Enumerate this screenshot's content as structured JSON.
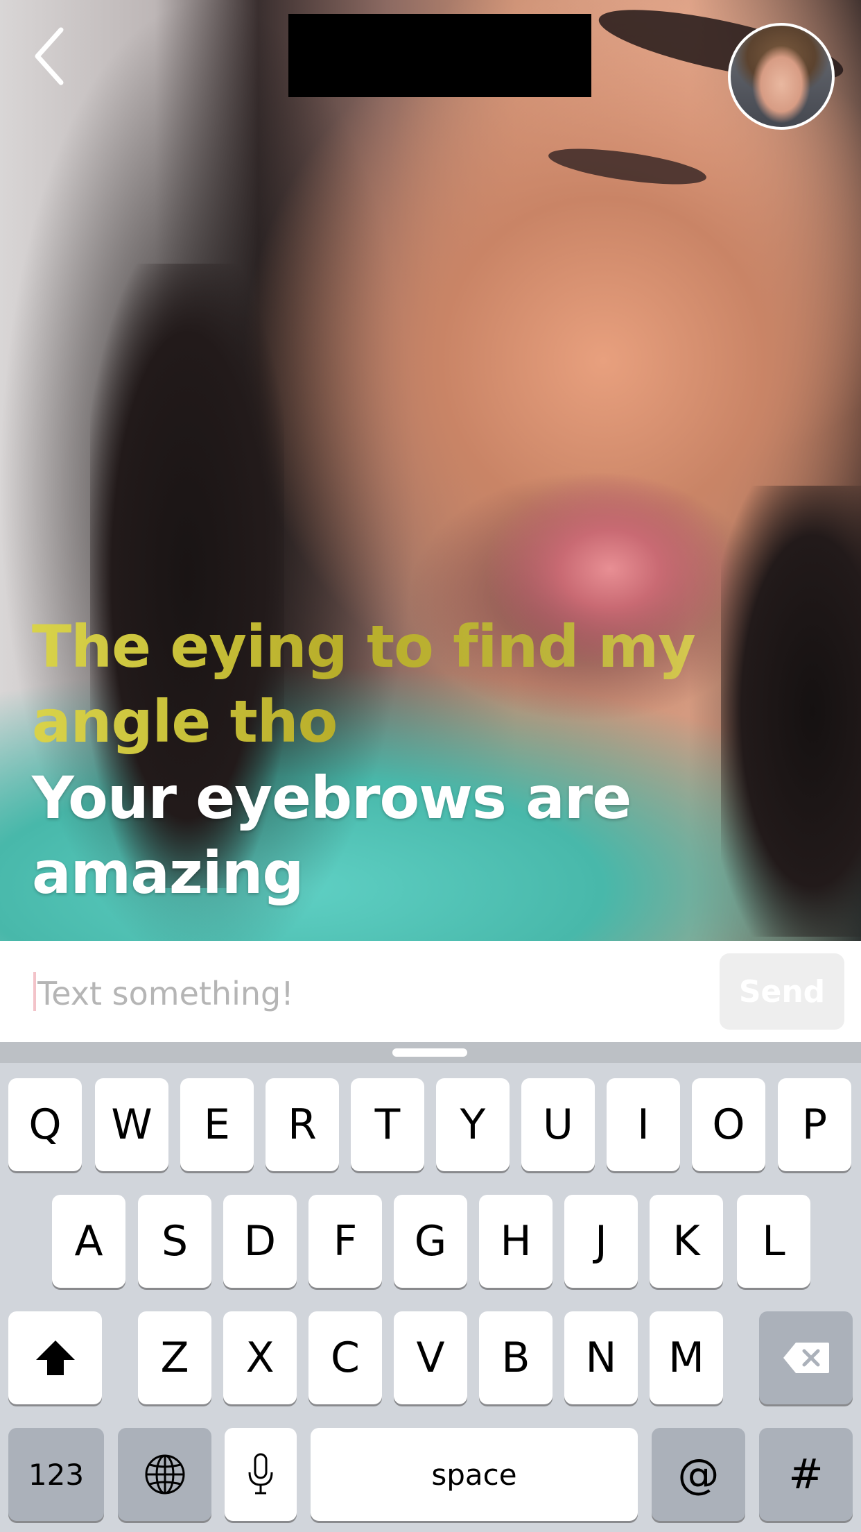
{
  "header": {
    "back_icon": "chevron-left-icon",
    "avatar_icon": "user-avatar"
  },
  "captions": [
    {
      "text": "The eying to find my angle tho",
      "color": "#c4bb35"
    },
    {
      "text": "Your eyebrows are amazing",
      "color": "#ffffff"
    }
  ],
  "composer": {
    "placeholder": "Text something!",
    "value": "",
    "send_label": "Send"
  },
  "keyboard": {
    "row1": [
      "Q",
      "W",
      "E",
      "R",
      "T",
      "Y",
      "U",
      "I",
      "O",
      "P"
    ],
    "row2": [
      "A",
      "S",
      "D",
      "F",
      "G",
      "H",
      "J",
      "K",
      "L"
    ],
    "row3": [
      "Z",
      "X",
      "C",
      "V",
      "B",
      "N",
      "M"
    ],
    "shift_icon": "shift-arrow-icon",
    "delete_icon": "backspace-icon",
    "numbers_label": "123",
    "globe_icon": "globe-icon",
    "mic_icon": "microphone-icon",
    "space_label": "space",
    "at_label": "@",
    "hash_label": "#"
  }
}
